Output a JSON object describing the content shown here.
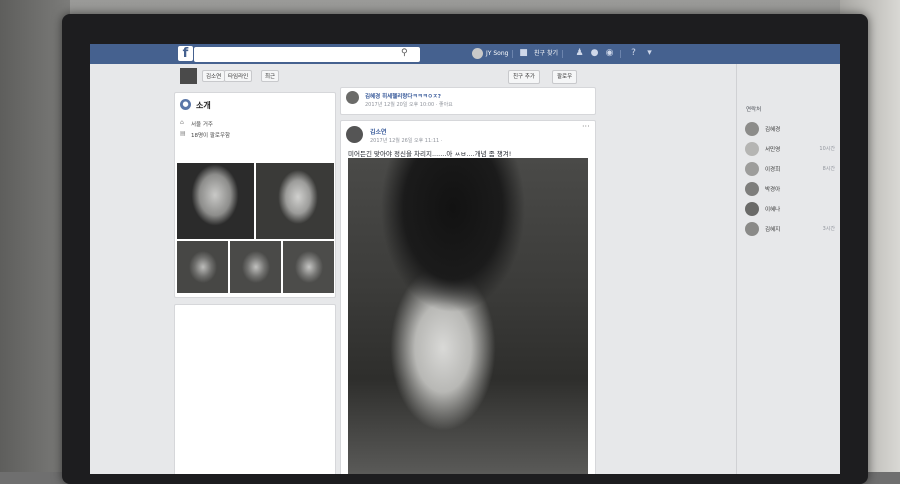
{
  "topbar": {
    "logo": "f",
    "search_placeholder": "",
    "user_name": "JY Song",
    "find_friends": "친구 찾기"
  },
  "profile_header": {
    "name": "김소연",
    "timeline": "타임라인",
    "recent": "최근",
    "add_friend": "친구 추가",
    "follow": "팔로우"
  },
  "intro": {
    "title": "소개",
    "lives_in": "서울 거주",
    "followers": "18명이 팔로우함"
  },
  "shared_post": {
    "author_line": "김혜경 히세헬리랑다ㅋㅋㅋㅇㅈ?",
    "meta": "2017년 12월 20일 오후 10:00 · 좋아요"
  },
  "main_post": {
    "author": "김소연",
    "meta": "2017년 12월 26일 오후 11:11 ·",
    "options": "···",
    "text": "미어든긴 맞아야 정신을 차리지.......아 ㅆㅂ....개념 좀 챙겨!"
  },
  "contacts": {
    "title": "연락처",
    "items": [
      {
        "name": "김혜경",
        "time": ""
      },
      {
        "name": "서민영",
        "time": "10시간"
      },
      {
        "name": "이경희",
        "time": "8시간"
      },
      {
        "name": "박경아",
        "time": ""
      },
      {
        "name": "이혜나",
        "time": ""
      },
      {
        "name": "김혜지",
        "time": "3시간"
      }
    ]
  },
  "colors": {
    "topbar": "#45618f",
    "link": "#365899"
  },
  "icons": [
    "search-icon",
    "friends-icon",
    "messenger-icon",
    "globe-icon",
    "help-icon",
    "dropdown-icon",
    "home-icon",
    "calendar-icon"
  ]
}
